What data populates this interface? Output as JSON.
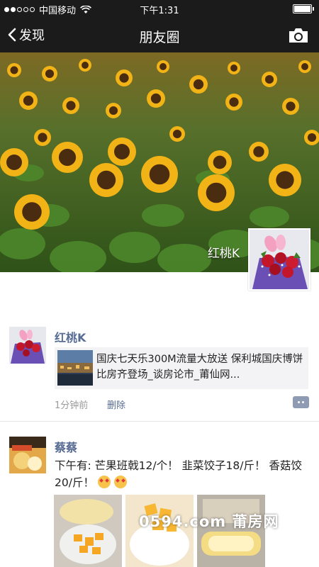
{
  "status_bar": {
    "carrier": "中国移动",
    "time": "下午1:31"
  },
  "nav": {
    "back_label": "发现",
    "title": "朋友圈"
  },
  "cover": {
    "user_name": "红桃K"
  },
  "posts": [
    {
      "author": "红桃K",
      "share_text": "国庆七天乐300M流量大放送 保利城国庆博饼比房齐登场_谈房论市_莆仙网...",
      "time_ago": "1分钟前",
      "delete_label": "删除"
    },
    {
      "author": "蔡蔡",
      "text": "下午有: 芒果班戟12/个！ 韭菜饺子18/斤！ 香菇饺20/斤！"
    }
  ],
  "watermark": "0594.com 莆房网",
  "icons": [
    "wifi-icon",
    "battery-icon",
    "chevron-left-icon",
    "camera-icon",
    "comment-icon",
    "heart-eyes-emoji"
  ]
}
